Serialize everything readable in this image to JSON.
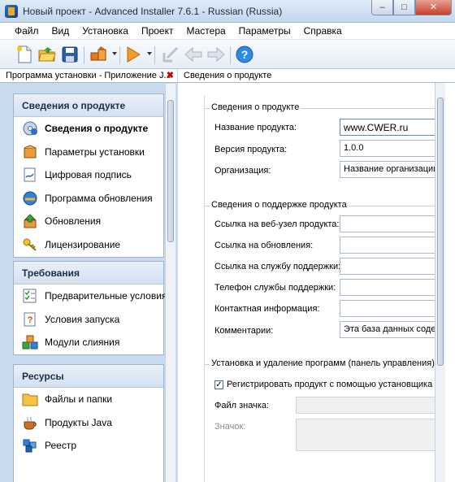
{
  "window": {
    "title": "Новый проект - Advanced Installer 7.6.1 - Russian (Russia)",
    "minimize": "–",
    "maximize": "□",
    "close": "✕"
  },
  "menu": [
    "Файл",
    "Вид",
    "Установка",
    "Проект",
    "Мастера",
    "Параметры",
    "Справка"
  ],
  "left_panel": {
    "tab_label": "Программа установки - Приложение J...",
    "tab_close": "✖",
    "groups": [
      {
        "title": "Сведения о продукте",
        "items": [
          {
            "label": "Сведения о продукте",
            "icon": "cd-info-icon",
            "active": true
          },
          {
            "label": "Параметры установки",
            "icon": "package-icon"
          },
          {
            "label": "Цифровая подпись",
            "icon": "signature-icon"
          },
          {
            "label": "Программа обновления",
            "icon": "update-program-icon"
          },
          {
            "label": "Обновления",
            "icon": "updates-icon"
          },
          {
            "label": "Лицензирование",
            "icon": "license-key-icon"
          }
        ]
      },
      {
        "title": "Требования",
        "items": [
          {
            "label": "Предварительные условия",
            "icon": "checklist-icon"
          },
          {
            "label": "Условия запуска",
            "icon": "launch-conditions-icon"
          },
          {
            "label": "Модули слияния",
            "icon": "merge-modules-icon"
          }
        ]
      },
      {
        "title": "Ресурсы",
        "items": [
          {
            "label": "Файлы и папки",
            "icon": "folder-icon"
          },
          {
            "label": "Продукты Java",
            "icon": "java-cup-icon"
          },
          {
            "label": "Реестр",
            "icon": "registry-icon"
          }
        ]
      }
    ]
  },
  "right_panel": {
    "header": "Сведения о продукте",
    "product_info": {
      "title": "Сведения о продукте",
      "fields": [
        {
          "label": "Название продукта:",
          "value": "www.CWER.ru"
        },
        {
          "label": "Версия продукта:",
          "value": "1.0.0"
        },
        {
          "label": "Организация:",
          "value": "Название организации"
        }
      ]
    },
    "support_info": {
      "title": "Сведения о поддержке продукта",
      "fields": [
        {
          "label": "Ссылка на веб-узел продукта:",
          "value": ""
        },
        {
          "label": "Ссылка на обновления:",
          "value": ""
        },
        {
          "label": "Ссылка на службу поддержки:",
          "value": ""
        },
        {
          "label": "Телефон службы поддержки:",
          "value": ""
        },
        {
          "label": "Контактная информация:",
          "value": ""
        },
        {
          "label": "Комментарии:",
          "value": "Эта база данных содерж"
        }
      ]
    },
    "add_remove": {
      "title": "Установка и удаление программ (панель управления)",
      "register_checkbox": "Регистрировать продукт с помощью установщика Windo",
      "register_checked": true,
      "icon_file_label": "Файл значка:",
      "icon_label": "Значок:"
    }
  }
}
